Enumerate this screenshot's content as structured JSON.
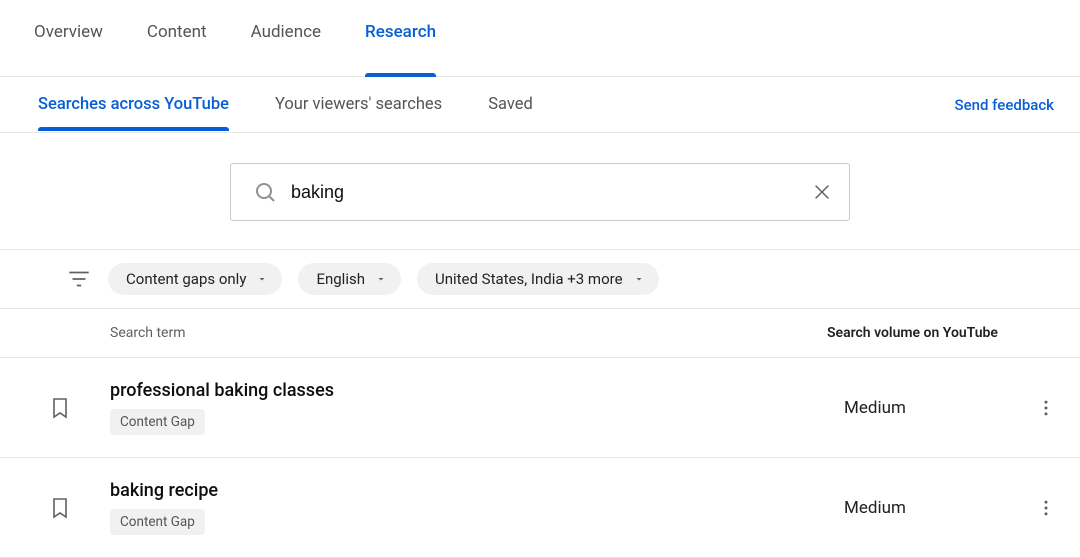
{
  "top_tabs": [
    {
      "label": "Overview",
      "active": false
    },
    {
      "label": "Content",
      "active": false
    },
    {
      "label": "Audience",
      "active": false
    },
    {
      "label": "Research",
      "active": true
    }
  ],
  "sub_tabs": [
    {
      "label": "Searches across YouTube",
      "active": true
    },
    {
      "label": "Your viewers' searches",
      "active": false
    },
    {
      "label": "Saved",
      "active": false
    }
  ],
  "send_feedback_label": "Send feedback",
  "search": {
    "value": "baking",
    "placeholder": ""
  },
  "filters": [
    {
      "label": "Content gaps only"
    },
    {
      "label": "English"
    },
    {
      "label": "United States, India +3 more"
    }
  ],
  "columns": {
    "term": "Search term",
    "volume": "Search volume on YouTube"
  },
  "rows": [
    {
      "term": "professional baking classes",
      "badge": "Content Gap",
      "volume": "Medium"
    },
    {
      "term": "baking recipe",
      "badge": "Content Gap",
      "volume": "Medium"
    }
  ]
}
